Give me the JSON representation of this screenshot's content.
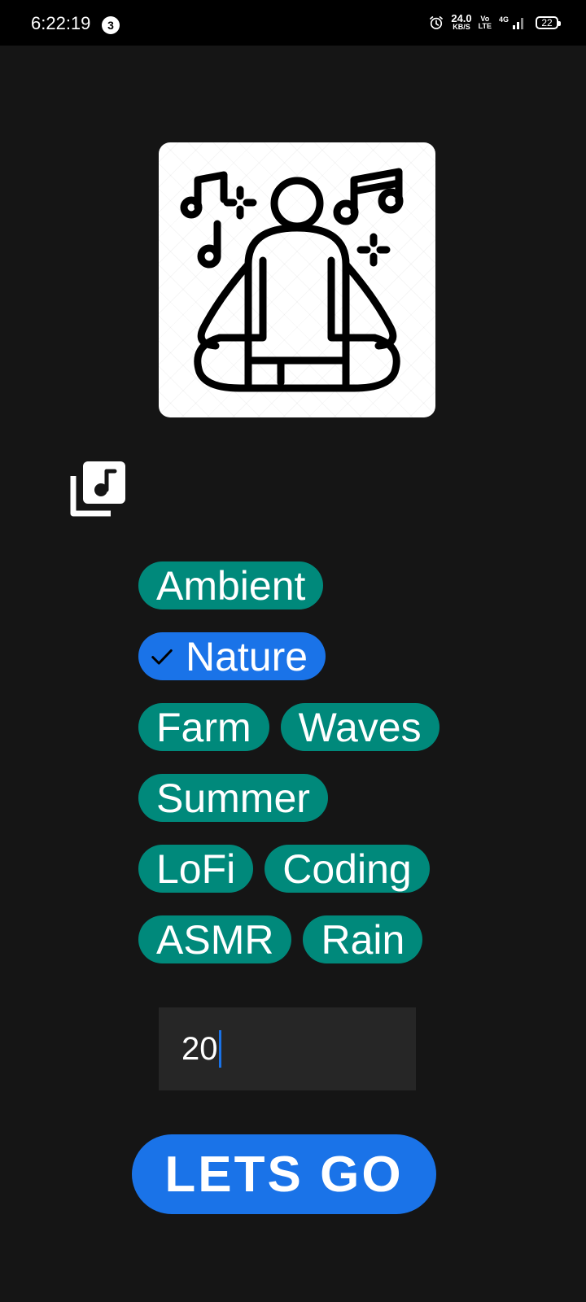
{
  "status_bar": {
    "time": "6:22:19",
    "notification_count": "3",
    "net_speed_value": "24.0",
    "net_speed_unit": "KB/S",
    "volte_top": "Vo",
    "volte_bottom": "LTE",
    "network_type": "4G",
    "battery_level": "22"
  },
  "hero": {
    "icon": "meditation-music-icon"
  },
  "library": {
    "icon": "music-library-icon"
  },
  "chips": [
    {
      "label": "Ambient",
      "selected": false
    },
    {
      "label": "Nature",
      "selected": true
    },
    {
      "label": "Farm",
      "selected": false
    },
    {
      "label": "Waves",
      "selected": false
    },
    {
      "label": "Summer",
      "selected": false
    },
    {
      "label": "LoFi",
      "selected": false
    },
    {
      "label": "Coding",
      "selected": false
    },
    {
      "label": "ASMR",
      "selected": false
    },
    {
      "label": "Rain",
      "selected": false
    }
  ],
  "number_input": {
    "value": "20"
  },
  "go_button": {
    "label": "LETS GO"
  },
  "colors": {
    "background": "#151515",
    "chip": "#00897b",
    "chip_selected": "#1a73e8",
    "button": "#1a73e8",
    "input": "#262626"
  }
}
